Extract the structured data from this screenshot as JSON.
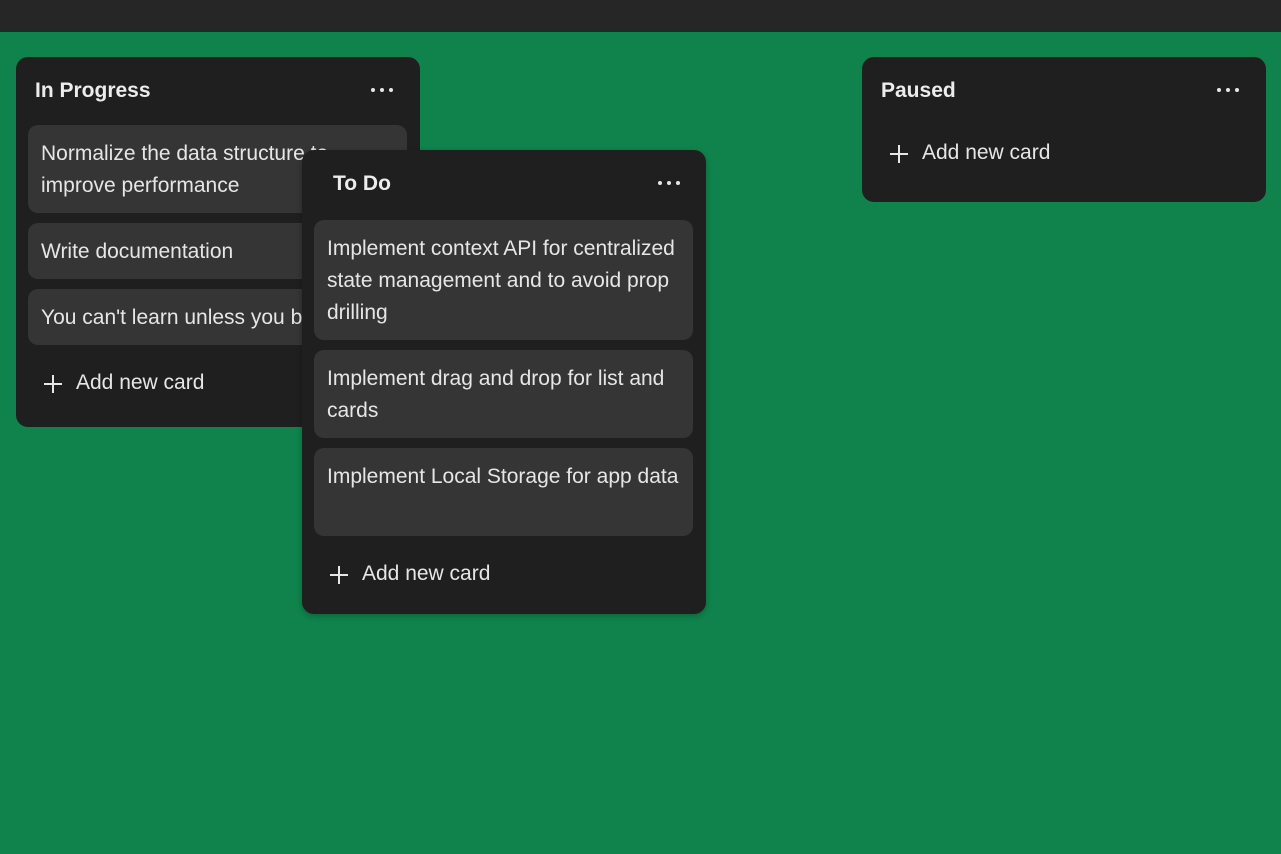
{
  "lists": [
    {
      "id": "in-progress",
      "title": "In Progress",
      "cards": [
        "Normalize the data structure to improve performance",
        "Write documentation",
        "You can't learn unless you build"
      ],
      "add_label": "Add new card"
    },
    {
      "id": "to-do",
      "title": "To Do",
      "cards": [
        "Implement context API for centralized state management and to avoid prop drilling",
        "Implement drag and drop for list and cards",
        "Implement Local Storage for app data"
      ],
      "add_label": "Add new card"
    },
    {
      "id": "paused",
      "title": "Paused",
      "cards": [],
      "add_label": "Add new card"
    }
  ],
  "icons": {
    "menu": "more-horizontal-icon",
    "add": "plus-icon"
  },
  "colors": {
    "board_background": "#0f834b",
    "top_bar": "#262626",
    "list_background": "#1f1f1f",
    "card_background": "#353535",
    "text": "#e6e6e6"
  }
}
